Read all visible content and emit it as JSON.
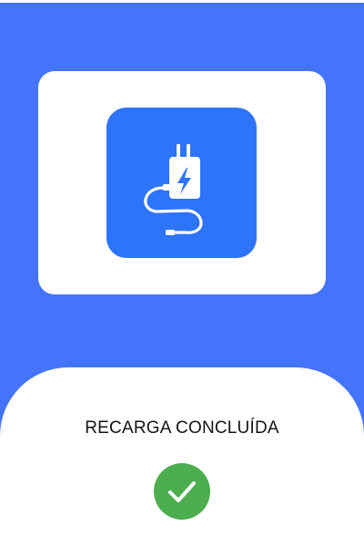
{
  "status": {
    "title": "RECARGA CONCLUÍDA"
  },
  "icons": {
    "main_icon": "charger-icon",
    "status_icon": "checkmark-icon"
  },
  "colors": {
    "background": "#4474fb",
    "icon_tile": "#2d74fb",
    "success": "#4cae4f",
    "card": "#ffffff"
  }
}
